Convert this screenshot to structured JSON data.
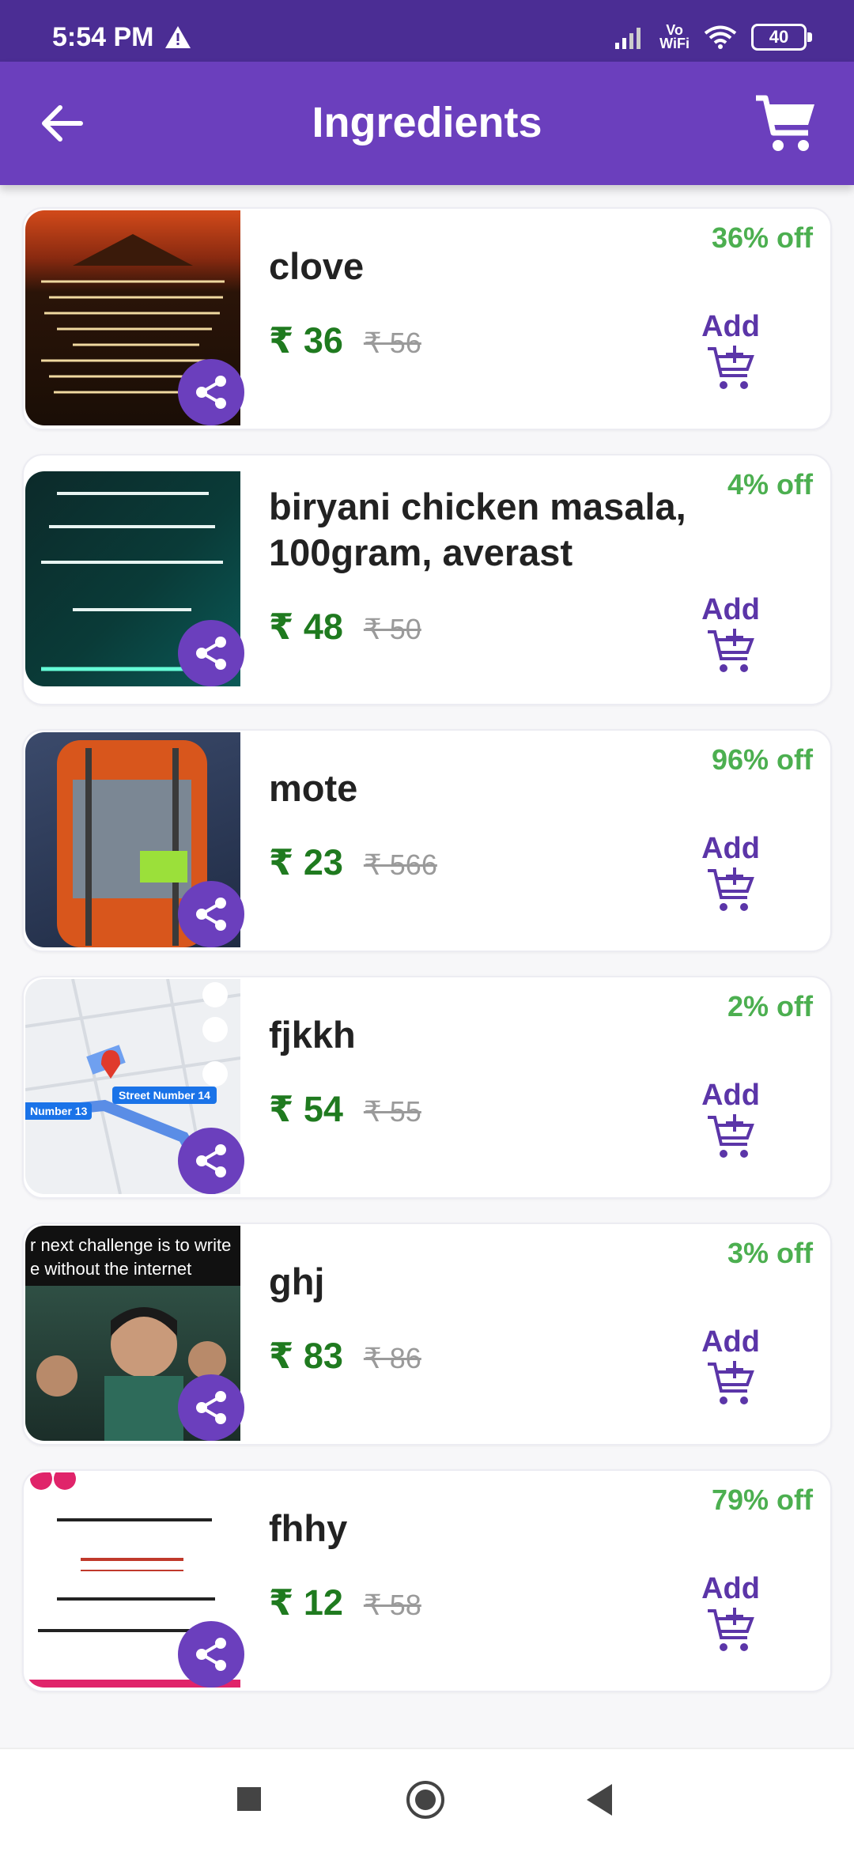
{
  "status_bar": {
    "time": "5:54 PM",
    "network": "Vo\nWiFi",
    "battery": "40"
  },
  "app_bar": {
    "title": "Ingredients"
  },
  "products": [
    {
      "name": "clove",
      "price": "₹ 36",
      "mrp": "₹ 56",
      "discount": "36% off",
      "add_label": "Add"
    },
    {
      "name": "biryani chicken masala, 100gram, averast",
      "price": "₹ 48",
      "mrp": "₹ 50",
      "discount": "4% off",
      "add_label": "Add"
    },
    {
      "name": "mote",
      "price": "₹ 23",
      "mrp": "₹ 566",
      "discount": "96% off",
      "add_label": "Add"
    },
    {
      "name": "fjkkh",
      "price": "₹ 54",
      "mrp": "₹ 55",
      "discount": "2% off",
      "add_label": "Add",
      "thumb_labels": {
        "street": "Street Number 14",
        "road": "Number 13"
      }
    },
    {
      "name": "ghj",
      "price": "₹ 83",
      "mrp": "₹ 86",
      "discount": "3% off",
      "add_label": "Add",
      "thumb_caption": "r next challenge is to write e without the internet"
    },
    {
      "name": "fhhy",
      "price": "₹ 12",
      "mrp": "₹ 58",
      "discount": "79% off",
      "add_label": "Add"
    }
  ],
  "colors": {
    "primary": "#6b3fbd",
    "status_bar": "#4b2d94",
    "discount": "#4caf50",
    "price": "#1f7a1f"
  },
  "icons": {
    "back": "arrow-left-icon",
    "cart": "shopping-cart-icon",
    "share": "share-icon",
    "add": "cart-plus-icon"
  }
}
